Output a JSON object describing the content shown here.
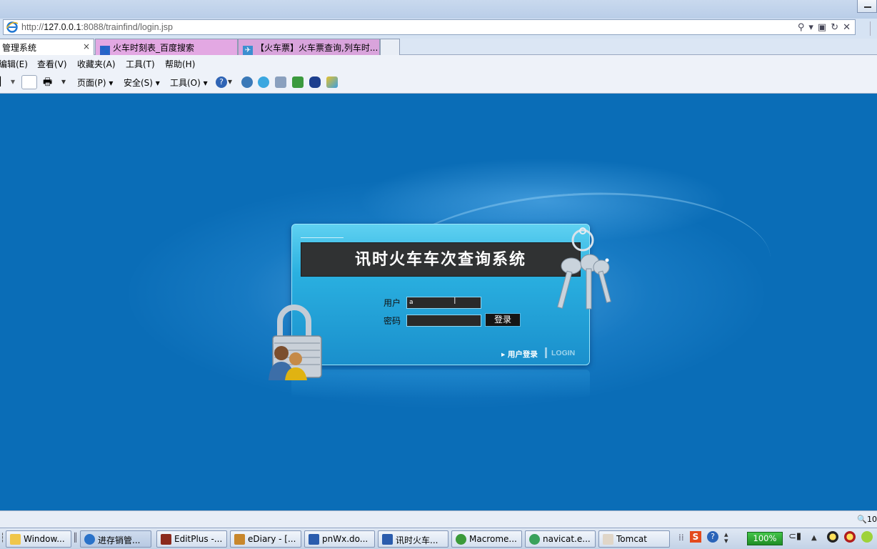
{
  "browser": {
    "url_prefix": "http://",
    "url_host": "127.0.0.1",
    "url_rest": ":8088/trainfind/login.jsp",
    "tabs": [
      {
        "label": "管理系统",
        "close": "×"
      },
      {
        "label": "火车时刻表_百度搜索"
      },
      {
        "label": "【火车票】火车票查询,列车时..."
      }
    ],
    "menu": [
      "编辑(E)",
      "查看(V)",
      "收藏夹(A)",
      "工具(T)",
      "帮助(H)"
    ],
    "toolbar": {
      "page": "页面(P)",
      "safety": "安全(S)",
      "tools": "工具(O)"
    },
    "status_zoom": "10"
  },
  "login": {
    "title": "讯时火车车次查询系统",
    "user_label": "用户",
    "user_value": "a",
    "password_label": "密码",
    "submit": "登录",
    "footer_cn": "▸ 用户登录",
    "footer_en": "LOGIN"
  },
  "taskbar": {
    "items": [
      "Window...",
      "进存销管...",
      "EditPlus -...",
      "eDiary - [...",
      "pnWx.do...",
      "讯时火车...",
      "Macrome...",
      "navicat.e...",
      "Tomcat"
    ],
    "battery": "100%"
  },
  "colors": {
    "content_bg": "#0a6db7",
    "panel": "#2ab0e0",
    "title_box": "#303233"
  }
}
